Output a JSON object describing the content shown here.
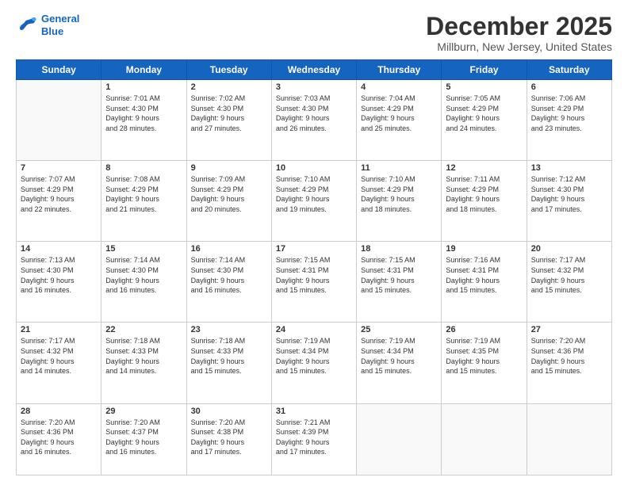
{
  "logo": {
    "line1": "General",
    "line2": "Blue"
  },
  "title": "December 2025",
  "location": "Millburn, New Jersey, United States",
  "days_header": [
    "Sunday",
    "Monday",
    "Tuesday",
    "Wednesday",
    "Thursday",
    "Friday",
    "Saturday"
  ],
  "weeks": [
    [
      {
        "num": "",
        "info": ""
      },
      {
        "num": "1",
        "info": "Sunrise: 7:01 AM\nSunset: 4:30 PM\nDaylight: 9 hours\nand 28 minutes."
      },
      {
        "num": "2",
        "info": "Sunrise: 7:02 AM\nSunset: 4:30 PM\nDaylight: 9 hours\nand 27 minutes."
      },
      {
        "num": "3",
        "info": "Sunrise: 7:03 AM\nSunset: 4:30 PM\nDaylight: 9 hours\nand 26 minutes."
      },
      {
        "num": "4",
        "info": "Sunrise: 7:04 AM\nSunset: 4:29 PM\nDaylight: 9 hours\nand 25 minutes."
      },
      {
        "num": "5",
        "info": "Sunrise: 7:05 AM\nSunset: 4:29 PM\nDaylight: 9 hours\nand 24 minutes."
      },
      {
        "num": "6",
        "info": "Sunrise: 7:06 AM\nSunset: 4:29 PM\nDaylight: 9 hours\nand 23 minutes."
      }
    ],
    [
      {
        "num": "7",
        "info": "Sunrise: 7:07 AM\nSunset: 4:29 PM\nDaylight: 9 hours\nand 22 minutes."
      },
      {
        "num": "8",
        "info": "Sunrise: 7:08 AM\nSunset: 4:29 PM\nDaylight: 9 hours\nand 21 minutes."
      },
      {
        "num": "9",
        "info": "Sunrise: 7:09 AM\nSunset: 4:29 PM\nDaylight: 9 hours\nand 20 minutes."
      },
      {
        "num": "10",
        "info": "Sunrise: 7:10 AM\nSunset: 4:29 PM\nDaylight: 9 hours\nand 19 minutes."
      },
      {
        "num": "11",
        "info": "Sunrise: 7:10 AM\nSunset: 4:29 PM\nDaylight: 9 hours\nand 18 minutes."
      },
      {
        "num": "12",
        "info": "Sunrise: 7:11 AM\nSunset: 4:29 PM\nDaylight: 9 hours\nand 18 minutes."
      },
      {
        "num": "13",
        "info": "Sunrise: 7:12 AM\nSunset: 4:30 PM\nDaylight: 9 hours\nand 17 minutes."
      }
    ],
    [
      {
        "num": "14",
        "info": "Sunrise: 7:13 AM\nSunset: 4:30 PM\nDaylight: 9 hours\nand 16 minutes."
      },
      {
        "num": "15",
        "info": "Sunrise: 7:14 AM\nSunset: 4:30 PM\nDaylight: 9 hours\nand 16 minutes."
      },
      {
        "num": "16",
        "info": "Sunrise: 7:14 AM\nSunset: 4:30 PM\nDaylight: 9 hours\nand 16 minutes."
      },
      {
        "num": "17",
        "info": "Sunrise: 7:15 AM\nSunset: 4:31 PM\nDaylight: 9 hours\nand 15 minutes."
      },
      {
        "num": "18",
        "info": "Sunrise: 7:15 AM\nSunset: 4:31 PM\nDaylight: 9 hours\nand 15 minutes."
      },
      {
        "num": "19",
        "info": "Sunrise: 7:16 AM\nSunset: 4:31 PM\nDaylight: 9 hours\nand 15 minutes."
      },
      {
        "num": "20",
        "info": "Sunrise: 7:17 AM\nSunset: 4:32 PM\nDaylight: 9 hours\nand 15 minutes."
      }
    ],
    [
      {
        "num": "21",
        "info": "Sunrise: 7:17 AM\nSunset: 4:32 PM\nDaylight: 9 hours\nand 14 minutes."
      },
      {
        "num": "22",
        "info": "Sunrise: 7:18 AM\nSunset: 4:33 PM\nDaylight: 9 hours\nand 14 minutes."
      },
      {
        "num": "23",
        "info": "Sunrise: 7:18 AM\nSunset: 4:33 PM\nDaylight: 9 hours\nand 15 minutes."
      },
      {
        "num": "24",
        "info": "Sunrise: 7:19 AM\nSunset: 4:34 PM\nDaylight: 9 hours\nand 15 minutes."
      },
      {
        "num": "25",
        "info": "Sunrise: 7:19 AM\nSunset: 4:34 PM\nDaylight: 9 hours\nand 15 minutes."
      },
      {
        "num": "26",
        "info": "Sunrise: 7:19 AM\nSunset: 4:35 PM\nDaylight: 9 hours\nand 15 minutes."
      },
      {
        "num": "27",
        "info": "Sunrise: 7:20 AM\nSunset: 4:36 PM\nDaylight: 9 hours\nand 15 minutes."
      }
    ],
    [
      {
        "num": "28",
        "info": "Sunrise: 7:20 AM\nSunset: 4:36 PM\nDaylight: 9 hours\nand 16 minutes."
      },
      {
        "num": "29",
        "info": "Sunrise: 7:20 AM\nSunset: 4:37 PM\nDaylight: 9 hours\nand 16 minutes."
      },
      {
        "num": "30",
        "info": "Sunrise: 7:20 AM\nSunset: 4:38 PM\nDaylight: 9 hours\nand 17 minutes."
      },
      {
        "num": "31",
        "info": "Sunrise: 7:21 AM\nSunset: 4:39 PM\nDaylight: 9 hours\nand 17 minutes."
      },
      {
        "num": "",
        "info": ""
      },
      {
        "num": "",
        "info": ""
      },
      {
        "num": "",
        "info": ""
      }
    ]
  ]
}
